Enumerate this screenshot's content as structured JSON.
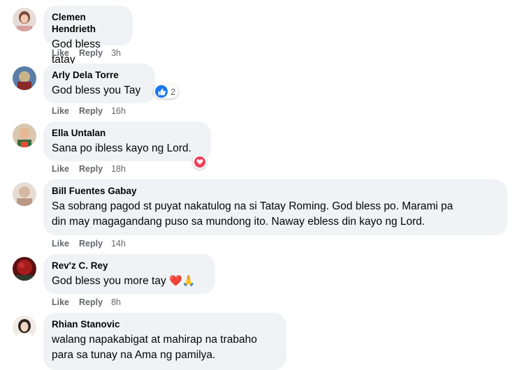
{
  "comments": [
    {
      "author": "Clemen Hendrieth",
      "text": "God bless tatay",
      "like": "Like",
      "reply": "Reply",
      "time": "3h",
      "avatar_colors": [
        "#e8ddd6",
        "#7a4a3a"
      ]
    },
    {
      "author": "Arly Dela Torre",
      "text": "God bless you Tay",
      "like": "Like",
      "reply": "Reply",
      "time": "16h",
      "reaction_count": "2",
      "reaction_icon": "thumbs-up-icon",
      "avatar_colors": [
        "#5b7da8",
        "#c9b48a"
      ]
    },
    {
      "author": "Ella Untalan",
      "text": "Sana po ibless kayo ng Lord.",
      "like": "Like",
      "reply": "Reply",
      "time": "18h",
      "reaction_icon": "heart-icon",
      "avatar_colors": [
        "#d9c7b0",
        "#3a6b3a"
      ]
    },
    {
      "author": "Bill Fuentes Gabay",
      "text_lines": [
        "Sa sobrang pagod st puyat nakatulog na si Tatay Roming. God bless po. Marami pa",
        "din may magagandang puso sa mundong ito. Naway ebless din kayo ng Lord."
      ],
      "like": "Like",
      "reply": "Reply",
      "time": "14h",
      "avatar_colors": [
        "#e6dcd4",
        "#b99a86"
      ]
    },
    {
      "author": "Rev'z C. Rey",
      "text": "God bless you more tay",
      "emojis": [
        "❤️",
        "🙏"
      ],
      "like": "Like",
      "reply": "Reply",
      "time": "8h",
      "avatar_colors": [
        "#a51d1d",
        "#5a1010"
      ]
    },
    {
      "author": "Rhian Stanovic",
      "text_lines": [
        "walang napakabigat at mahirap na trabaho",
        "para sa tunay na Ama ng pamilya."
      ],
      "avatar_colors": [
        "#f1ebe6",
        "#2c2220"
      ]
    }
  ],
  "colors": {
    "bubble": "#f0f2f5",
    "secondary_text": "#65676b",
    "like_blue": "#1877f2",
    "heart_red": "#f33e58"
  }
}
